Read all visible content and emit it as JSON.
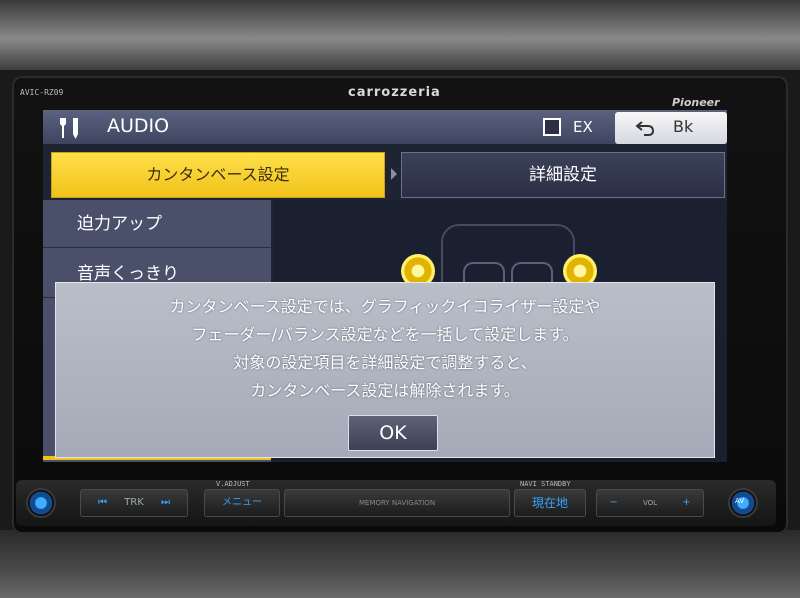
{
  "device": {
    "model": "AVIC-RZ09",
    "brand": "carrozzeria",
    "maker": "Pioneer"
  },
  "header": {
    "title": "AUDIO",
    "ex_label": "EX",
    "back_label": "Bk"
  },
  "tabs": {
    "easy": "カンタンベース設定",
    "detail": "詳細設定",
    "active": "easy"
  },
  "sidebar": {
    "items": [
      {
        "label": "迫力アップ"
      },
      {
        "label": "音声くっきり"
      }
    ]
  },
  "dialog": {
    "lines": [
      "カンタンベース設定では、グラフィックイコライザー設定や",
      "フェーダー/バランス設定などを一括して設定します。",
      "対象の設定項目を詳細設定で調整すると、",
      "カンタンベース設定は解除されます。"
    ],
    "ok_label": "OK"
  },
  "hardware": {
    "trk_label": "TRK",
    "menu_label": "メニュー",
    "memory_label": "MEMORY NAVIGATION",
    "location_label": "現在地",
    "vol_label": "VOL",
    "minus": "−",
    "plus": "+",
    "av_label": "AV",
    "vadjust_label": "V.ADJUST",
    "navi_label": "NAVI STANDBY"
  },
  "colors": {
    "accent_yellow": "#f0c21a",
    "panel_dark": "#2a2f44",
    "hw_blue": "#36a3ff"
  }
}
